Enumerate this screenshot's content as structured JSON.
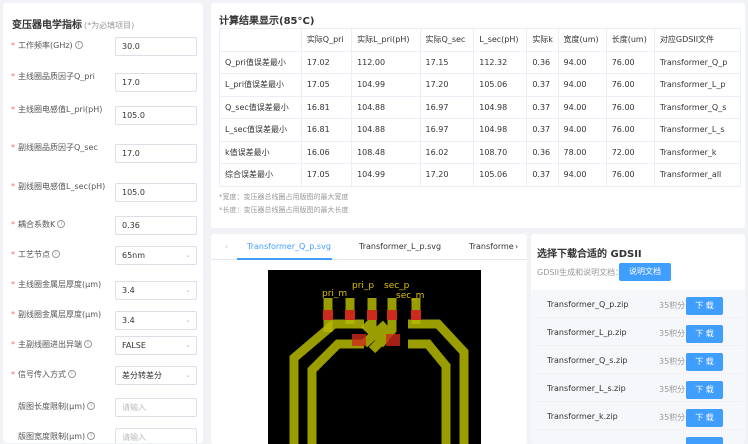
{
  "left": {
    "title": "变压器电学指标",
    "subtitle": "(*为必填项目)",
    "fields": [
      {
        "label": "工作频率(GHz)",
        "required": true,
        "help": true,
        "value": "30.0",
        "placeholder": "",
        "type": "input"
      },
      {
        "label": "主线圈品质因子Q_pri",
        "required": true,
        "help": false,
        "value": "17.0",
        "placeholder": "",
        "type": "input"
      },
      {
        "label": "主线圈电感值L_pri(pH)",
        "required": true,
        "help": false,
        "value": "105.0",
        "placeholder": "",
        "type": "input"
      },
      {
        "label": "副线圈品质因子Q_sec",
        "required": true,
        "help": false,
        "value": "17.0",
        "placeholder": "",
        "type": "input"
      },
      {
        "label": "副线圈电感值L_sec(pH)",
        "required": true,
        "help": false,
        "value": "105.0",
        "placeholder": "",
        "type": "input"
      },
      {
        "label": "耦合系数K",
        "required": true,
        "help": true,
        "value": "0.36",
        "placeholder": "",
        "type": "input"
      },
      {
        "label": "工艺节点",
        "required": true,
        "help": true,
        "value": "65nm",
        "placeholder": "",
        "type": "select"
      },
      {
        "label": "主线圈金属层厚度(μm)",
        "required": true,
        "help": false,
        "value": "3.4",
        "placeholder": "",
        "type": "select"
      },
      {
        "label": "副线圈金属层厚度(μm)",
        "required": true,
        "help": false,
        "value": "3.4",
        "placeholder": "",
        "type": "select"
      },
      {
        "label": "主副线圈进出异端",
        "required": true,
        "help": true,
        "value": "FALSE",
        "placeholder": "",
        "type": "select"
      },
      {
        "label": "信号传入方式",
        "required": true,
        "help": true,
        "value": "差分转差分",
        "placeholder": "",
        "type": "select"
      },
      {
        "label": "版图长度限制(μm)",
        "required": false,
        "help": true,
        "value": "",
        "placeholder": "请输入",
        "type": "input"
      },
      {
        "label": "版图宽度限制(μm)",
        "required": false,
        "help": true,
        "value": "",
        "placeholder": "请输入",
        "type": "input"
      }
    ]
  },
  "result": {
    "title": "计算结果显示(85°C)",
    "headers": [
      "",
      "实际Q_pri",
      "实际L_pri(pH)",
      "实际Q_sec",
      "L_sec(pH)",
      "实际k",
      "宽度(um)",
      "长度(um)",
      "对应GDSII文件"
    ],
    "rows": [
      [
        "Q_pri值误差最小",
        "17.02",
        "112.00",
        "17.15",
        "112.32",
        "0.36",
        "94.00",
        "76.00",
        "Transformer_Q_p"
      ],
      [
        "L_pri值误差最小",
        "17.05",
        "104.99",
        "17.20",
        "105.06",
        "0.37",
        "94.00",
        "76.00",
        "Transformer_L_p"
      ],
      [
        "Q_sec值误差最小",
        "16.81",
        "104.88",
        "16.97",
        "104.98",
        "0.37",
        "94.00",
        "76.00",
        "Transformer_Q_s"
      ],
      [
        "L_sec值误差最小",
        "16.81",
        "104.88",
        "16.97",
        "104.98",
        "0.37",
        "94.00",
        "76.00",
        "Transformer_L_s"
      ],
      [
        "k值误差最小",
        "16.06",
        "108.48",
        "16.02",
        "108.70",
        "0.36",
        "78.00",
        "72.00",
        "Transformer_k"
      ],
      [
        "综合误差最小",
        "17.05",
        "104.99",
        "17.20",
        "105.06",
        "0.37",
        "94.00",
        "76.00",
        "Transformer_all"
      ]
    ],
    "notes": [
      "*宽度：变压器总线圈占用版图的最大宽度",
      "*长度：变压器总线圈占用版图的最大长度"
    ]
  },
  "viewer": {
    "tabs": [
      "Transformer_Q_p.svg",
      "Transformer_L_p.svg",
      "Transforme"
    ],
    "active_tab": 0,
    "prev_icon": "chevron-left-icon",
    "next_icon": "chevron-right-icon",
    "layout_labels": [
      "pri_m",
      "pri_p",
      "sec_p",
      "sec_m"
    ],
    "colors": {
      "metal": "#b5b800",
      "via": "#cc2a1a",
      "bg": "#000000"
    }
  },
  "download": {
    "title": "选择下载合适的 GDSII",
    "doc_prompt": "GDSII生成和说明文档：",
    "doc_button": "说明文档",
    "items": [
      {
        "file": "Transformer_Q_p.zip",
        "points": "35积分",
        "button": "下 载"
      },
      {
        "file": "Transformer_L_p.zip",
        "points": "35积分",
        "button": "下 载"
      },
      {
        "file": "Transformer_Q_s.zip",
        "points": "35积分",
        "button": "下 载"
      },
      {
        "file": "Transformer_L_s.zip",
        "points": "35积分",
        "button": "下 载"
      },
      {
        "file": "Transformer_k.zip",
        "points": "35积分",
        "button": "下 载"
      },
      {
        "file": "",
        "points": "",
        "button": ""
      }
    ],
    "accent": "#409eff"
  }
}
